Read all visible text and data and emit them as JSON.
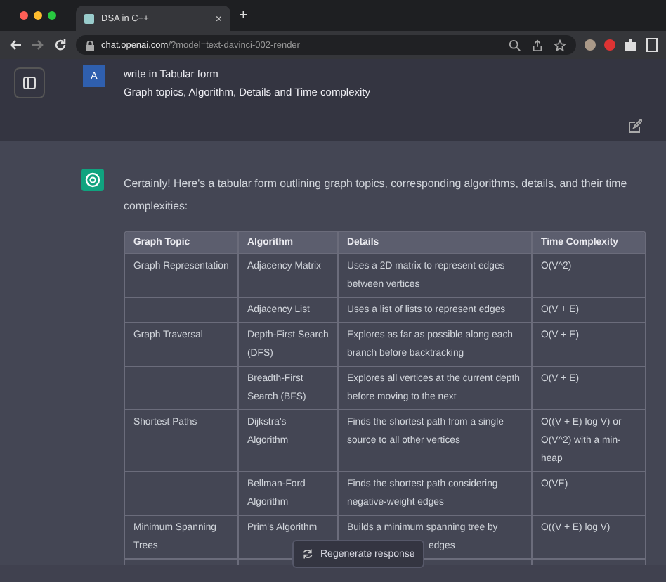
{
  "browser": {
    "tabs": [
      {
        "title": "DSA in C++",
        "selected": true
      }
    ],
    "close_glyph": "×",
    "new_tab_glyph": "+",
    "url_host": "chat.openai.com",
    "url_path": "/?model=text-davinci-002-render"
  },
  "user_message": {
    "avatar": "A",
    "lines": [
      "write in Tabular form",
      "Graph topics,  Algorithm, Details and Time complexity"
    ]
  },
  "assistant_message": {
    "intro": "Certainly! Here's a tabular form outlining graph topics, corresponding algorithms, details, and their time complexities:",
    "table": {
      "columns": [
        "Graph Topic",
        "Algorithm",
        "Details",
        "Time Complexity"
      ],
      "rows": [
        [
          "Graph Representation",
          "Adjacency Matrix",
          "Uses a 2D matrix to represent edges between vertices",
          "O(V^2)"
        ],
        [
          "",
          "Adjacency List",
          "Uses a list of lists to represent edges",
          "O(V + E)"
        ],
        [
          "Graph Traversal",
          "Depth-First Search (DFS)",
          "Explores as far as possible along each branch before backtracking",
          "O(V + E)"
        ],
        [
          "",
          "Breadth-First Search (BFS)",
          "Explores all vertices at the current depth before moving to the next",
          "O(V + E)"
        ],
        [
          "Shortest Paths",
          "Dijkstra's Algorithm",
          "Finds the shortest path from a single source to all other vertices",
          "O((V + E) log V) or O(V^2) with a min-heap"
        ],
        [
          "",
          "Bellman-Ford Algorithm",
          "Finds the shortest path considering negative-weight edges",
          "O(VE)"
        ],
        [
          "Minimum Spanning Trees",
          "Prim's Algorithm",
          "Builds a minimum spanning tree by",
          "O((V + E) log V)"
        ]
      ],
      "covered_fragment": "edges"
    }
  },
  "regenerate_button": {
    "label": "Regenerate response"
  }
}
